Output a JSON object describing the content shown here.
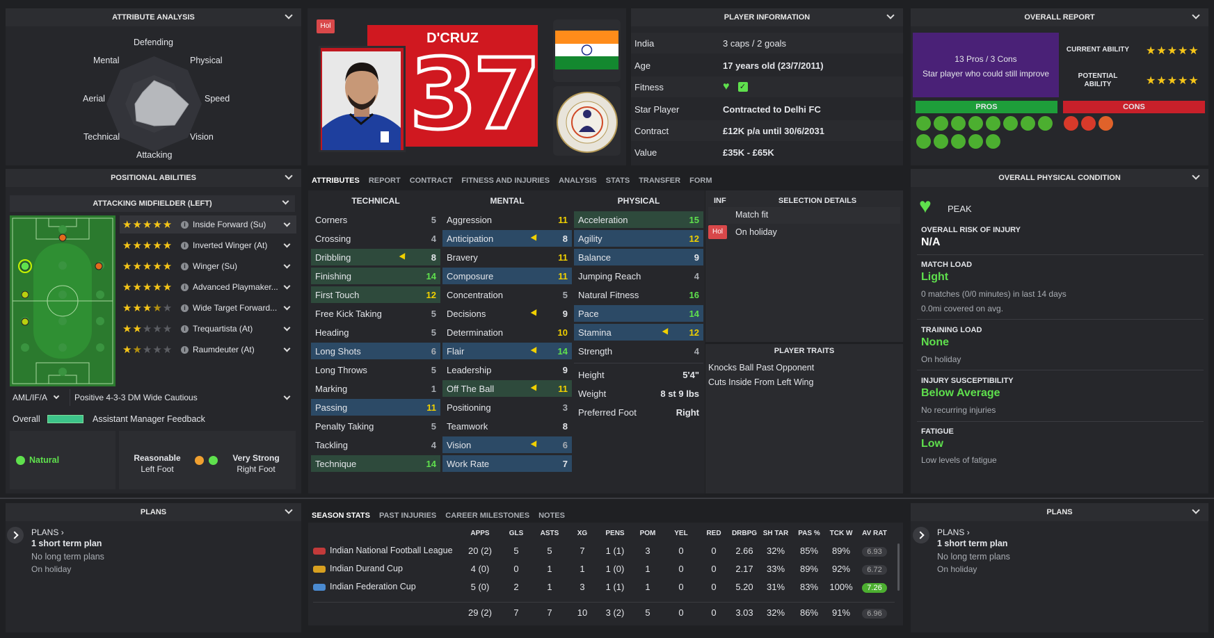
{
  "attribute_analysis": {
    "title": "ATTRIBUTE ANALYSIS",
    "axes": [
      "Defending",
      "Physical",
      "Speed",
      "Vision",
      "Attacking",
      "Technical",
      "Aerial",
      "Mental"
    ]
  },
  "header_card": {
    "status_badge": "Hol",
    "name": "D'CRUZ",
    "number": "37",
    "flag": "India",
    "club_crest_text": "SUDEVA DELHI FC"
  },
  "player_info": {
    "title": "PLAYER INFORMATION",
    "rows": [
      {
        "k": "India",
        "v": "3 caps / 2 goals"
      },
      {
        "k": "Age",
        "v": "17 years old (23/7/2011)"
      },
      {
        "k": "Fitness",
        "v": ""
      },
      {
        "k": "Star Player",
        "v": "Contracted to Delhi FC"
      },
      {
        "k": "Contract",
        "v": "£12K p/a until 30/6/2031"
      },
      {
        "k": "Value",
        "v": "£35K - £65K"
      }
    ]
  },
  "overall_report": {
    "title": "OVERALL REPORT",
    "summary_line1": "13 Pros / 3 Cons",
    "summary_line2": "Star player who could still improve",
    "current_ability_label": "CURRENT ABILITY",
    "current_ability_stars": 5,
    "potential_ability_label": "POTENTIAL ABILITY",
    "potential_ability_stars": 5,
    "pros_label": "PROS",
    "cons_label": "CONS",
    "pros_count": 13,
    "cons_count": 3
  },
  "positional": {
    "title": "POSITIONAL ABILITIES",
    "position_title": "ATTACKING MIDFIELDER (LEFT)",
    "roles": [
      {
        "name": "Inside Forward (Su)",
        "stars": 5
      },
      {
        "name": "Inverted Winger (At)",
        "stars": 5
      },
      {
        "name": "Winger (Su)",
        "stars": 5
      },
      {
        "name": "Advanced Playmaker...",
        "stars": 5
      },
      {
        "name": "Wide Target Forward...",
        "stars": 3.5
      },
      {
        "name": "Trequartista (At)",
        "stars": 2
      },
      {
        "name": "Raumdeuter (At)",
        "stars": 1.5
      }
    ],
    "position_select": "AML/IF/A",
    "tactic_select": "Positive 4-3-3 DM Wide Cautious",
    "overall_label": "Overall",
    "feedback_label": "Assistant Manager Feedback",
    "natural_label": "Natural",
    "left_foot_rating": "Reasonable",
    "left_foot_label": "Left Foot",
    "right_foot_rating": "Very Strong",
    "right_foot_label": "Right Foot"
  },
  "tabs": [
    "ATTRIBUTES",
    "REPORT",
    "CONTRACT",
    "FITNESS AND INJURIES",
    "ANALYSIS",
    "STATS",
    "TRANSFER",
    "FORM"
  ],
  "attributes": {
    "technical_title": "TECHNICAL",
    "mental_title": "MENTAL",
    "physical_title": "PHYSICAL",
    "technical": [
      {
        "n": "Corners",
        "v": "5"
      },
      {
        "n": "Crossing",
        "v": "4"
      },
      {
        "n": "Dribbling",
        "v": "8"
      },
      {
        "n": "Finishing",
        "v": "14"
      },
      {
        "n": "First Touch",
        "v": "12"
      },
      {
        "n": "Free Kick Taking",
        "v": "5"
      },
      {
        "n": "Heading",
        "v": "5"
      },
      {
        "n": "Long Shots",
        "v": "6"
      },
      {
        "n": "Long Throws",
        "v": "5"
      },
      {
        "n": "Marking",
        "v": "1"
      },
      {
        "n": "Passing",
        "v": "11"
      },
      {
        "n": "Penalty Taking",
        "v": "5"
      },
      {
        "n": "Tackling",
        "v": "4"
      },
      {
        "n": "Technique",
        "v": "14"
      }
    ],
    "mental": [
      {
        "n": "Aggression",
        "v": "11"
      },
      {
        "n": "Anticipation",
        "v": "8"
      },
      {
        "n": "Bravery",
        "v": "11"
      },
      {
        "n": "Composure",
        "v": "11"
      },
      {
        "n": "Concentration",
        "v": "5"
      },
      {
        "n": "Decisions",
        "v": "9"
      },
      {
        "n": "Determination",
        "v": "10"
      },
      {
        "n": "Flair",
        "v": "14"
      },
      {
        "n": "Leadership",
        "v": "9"
      },
      {
        "n": "Off The Ball",
        "v": "11"
      },
      {
        "n": "Positioning",
        "v": "3"
      },
      {
        "n": "Teamwork",
        "v": "8"
      },
      {
        "n": "Vision",
        "v": "6"
      },
      {
        "n": "Work Rate",
        "v": "7"
      }
    ],
    "physical": [
      {
        "n": "Acceleration",
        "v": "15"
      },
      {
        "n": "Agility",
        "v": "12"
      },
      {
        "n": "Balance",
        "v": "9"
      },
      {
        "n": "Jumping Reach",
        "v": "4"
      },
      {
        "n": "Natural Fitness",
        "v": "16"
      },
      {
        "n": "Pace",
        "v": "14"
      },
      {
        "n": "Stamina",
        "v": "12"
      },
      {
        "n": "Strength",
        "v": "4"
      }
    ],
    "bio": [
      {
        "n": "Height",
        "v": "5'4\""
      },
      {
        "n": "Weight",
        "v": "8 st 9 lbs"
      },
      {
        "n": "Preferred Foot",
        "v": "Right"
      }
    ]
  },
  "selection": {
    "inf_label": "INF",
    "title": "SELECTION DETAILS",
    "rows": [
      {
        "badge": "",
        "text": "Match fit"
      },
      {
        "badge": "Hol",
        "text": "On holiday"
      }
    ],
    "traits_title": "PLAYER TRAITS",
    "traits": [
      "Knocks Ball Past Opponent",
      "Cuts Inside From Left Wing"
    ]
  },
  "physical_condition": {
    "title": "OVERALL PHYSICAL CONDITION",
    "state": "PEAK",
    "risk_label": "OVERALL RISK OF INJURY",
    "risk_value": "N/A",
    "match_load_label": "MATCH LOAD",
    "match_load_value": "Light",
    "match_load_sub1": "0 matches (0/0 minutes) in last 14 days",
    "match_load_sub2": "0.0mi covered on avg.",
    "training_label": "TRAINING LOAD",
    "training_value": "None",
    "training_sub": "On holiday",
    "susceptibility_label": "INJURY SUSCEPTIBILITY",
    "susceptibility_value": "Below Average",
    "susceptibility_sub": "No recurring injuries",
    "fatigue_label": "FATIGUE",
    "fatigue_value": "Low",
    "fatigue_sub": "Low levels of fatigue"
  },
  "plans_left": {
    "title": "PLANS",
    "link": "PLANS",
    "count": "1 short term plan",
    "long": "No long term plans",
    "status": "On holiday"
  },
  "plans_right": {
    "title": "PLANS",
    "link": "PLANS",
    "count": "1 short term plan",
    "long": "No long term plans",
    "status": "On holiday"
  },
  "stats_tabs": [
    "SEASON STATS",
    "PAST INJURIES",
    "CAREER MILESTONES",
    "NOTES"
  ],
  "stats": {
    "headers": [
      "APPS",
      "GLS",
      "ASTS",
      "XG",
      "PENS",
      "POM",
      "YEL",
      "RED",
      "DRBPG",
      "SH TAR",
      "PAS %",
      "TCK W",
      "AV RAT"
    ],
    "rows": [
      {
        "comp": "Indian National Football League",
        "vals": [
          "20 (2)",
          "5",
          "5",
          "7",
          "1 (1)",
          "3",
          "0",
          "0",
          "2.66",
          "32%",
          "85%",
          "89%",
          "6.93"
        ],
        "rat_green": false
      },
      {
        "comp": "Indian Durand Cup",
        "vals": [
          "4 (0)",
          "0",
          "1",
          "1",
          "1 (0)",
          "1",
          "0",
          "0",
          "2.17",
          "33%",
          "89%",
          "92%",
          "6.72"
        ],
        "rat_green": false
      },
      {
        "comp": "Indian Federation Cup",
        "vals": [
          "5 (0)",
          "2",
          "1",
          "3",
          "1 (1)",
          "1",
          "0",
          "0",
          "5.20",
          "31%",
          "83%",
          "100%",
          "7.26"
        ],
        "rat_green": true
      }
    ],
    "total": [
      "29 (2)",
      "7",
      "7",
      "10",
      "3 (2)",
      "5",
      "0",
      "0",
      "3.03",
      "32%",
      "86%",
      "91%",
      "6.96"
    ]
  },
  "colors": {
    "accent_green": "#5fe04d",
    "pros_green": "#1e9e3a",
    "cons_red": "#c8202a",
    "purple": "#4a2177",
    "technical_highlight": "#2e4a3c",
    "mental_highlight": "#2c4a66"
  }
}
